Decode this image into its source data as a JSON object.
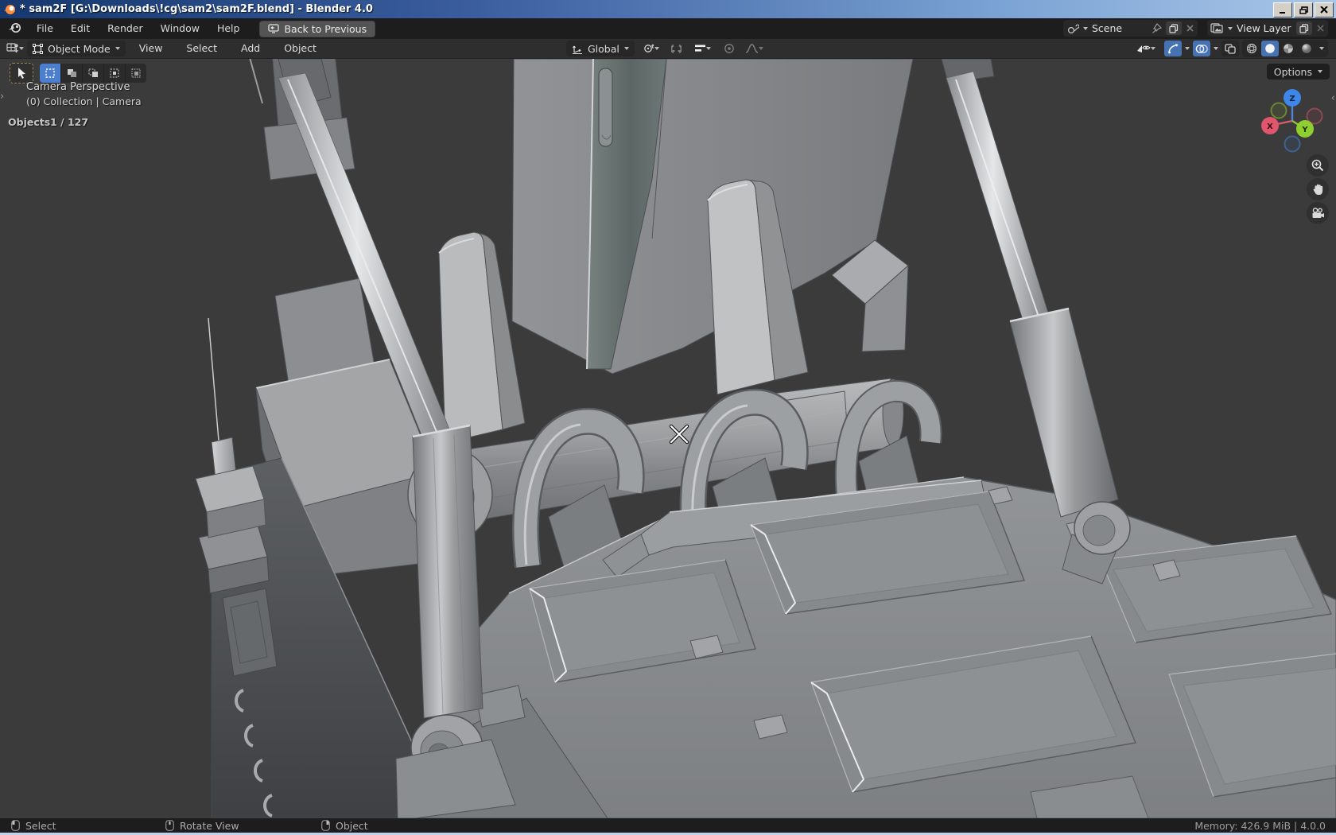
{
  "window": {
    "title": "* sam2F [G:\\Downloads\\!cg\\sam2\\sam2F.blend] - Blender 4.0"
  },
  "topbar": {
    "menus": [
      "File",
      "Edit",
      "Render",
      "Window",
      "Help"
    ],
    "back_button": "Back to Previous",
    "scene_selector": {
      "value": "Scene"
    },
    "view_layer_selector": {
      "value": "View Layer"
    }
  },
  "viewport_header": {
    "mode_selector": "Object Mode",
    "menus": [
      "View",
      "Select",
      "Add",
      "Object"
    ],
    "orientation_selector": "Global"
  },
  "viewport": {
    "options_button": "Options",
    "view_label": "Camera Perspective",
    "context_label": "(0) Collection | Camera",
    "stats": {
      "label": "Objects",
      "value": "1 / 127"
    },
    "gizmo": {
      "x_label": "X",
      "y_label": "Y",
      "z_label": "Z"
    }
  },
  "status_bar": {
    "select": "Select",
    "rotate_view": "Rotate View",
    "object": "Object",
    "memory": "Memory: 426.9 MiB | 4.0.0"
  },
  "colors": {
    "accent_blue": "#4772b3",
    "axis_x": "#e0566c",
    "axis_y": "#8fce2f",
    "axis_z": "#3e86e8",
    "viewport_bg": "#3b3b3b",
    "titlebar_left": "#16386e",
    "titlebar_right": "#aac6e8"
  }
}
